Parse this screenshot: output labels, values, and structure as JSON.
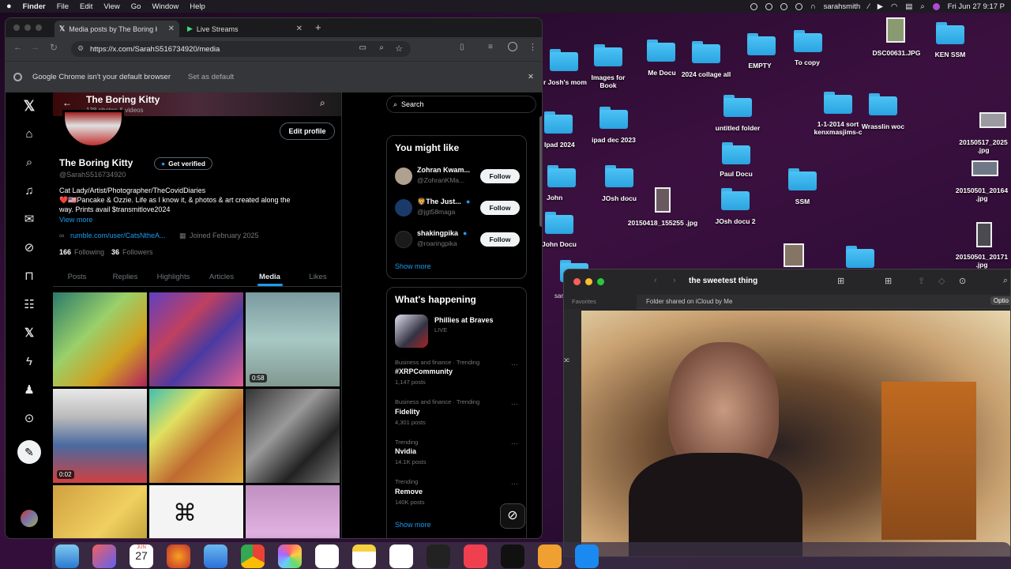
{
  "menubar": {
    "apple": "",
    "items": [
      "Finder",
      "File",
      "Edit",
      "View",
      "Go",
      "Window",
      "Help"
    ],
    "user": "sarahsmith",
    "datetime": "Fri Jun 27  9:17 P"
  },
  "chrome": {
    "tabs": [
      {
        "label": "Media posts by The Boring K",
        "icon": "x-logo-icon"
      },
      {
        "label": "Live Streams",
        "icon": "play-icon"
      }
    ],
    "url": "https://x.com/SarahS516734920/media",
    "infobar": {
      "message": "Google Chrome isn't your default browser",
      "action": "Set as default"
    }
  },
  "profile": {
    "header_name": "The Boring Kitty",
    "header_sub": "138 photos & videos",
    "edit_profile": "Edit profile",
    "display_name": "The Boring Kitty",
    "get_verified": "Get verified",
    "handle": "@SarahS516734920",
    "bio_line1": "Cat Lady/Artist/Photographer/TheCovidDiaries",
    "bio_line2": "❤️🇺🇸Pancake & Ozzie. Life as I know it, & photos & art created along the",
    "bio_line3": "way. Prints avail $transmitlove2024",
    "view_more": "View more",
    "link": "rumble.com/user/CatsNtheA...",
    "joined": "Joined February 2025",
    "following_count": "166",
    "following_label": "Following",
    "followers_count": "36",
    "followers_label": "Followers",
    "tabs": [
      "Posts",
      "Replies",
      "Highlights",
      "Articles",
      "Media",
      "Likes"
    ],
    "active_tab": "Media",
    "media": [
      {
        "badge": ""
      },
      {
        "badge": ""
      },
      {
        "badge": "0:58"
      },
      {
        "badge": "0:02"
      },
      {
        "badge": ""
      },
      {
        "badge": ""
      },
      {
        "badge": ""
      },
      {
        "badge": ""
      },
      {
        "badge": ""
      }
    ]
  },
  "sidebar": {
    "search_placeholder": "Search",
    "you_might_like": "You might like",
    "suggestions": [
      {
        "name": "Zohran Kwam...",
        "handle": "@ZohranKMa...",
        "button": "Follow"
      },
      {
        "name": "🦁The Just...",
        "handle": "@jgt58maga",
        "button": "Follow"
      },
      {
        "name": "shakingpika",
        "handle": "@roaringpika",
        "button": "Follow"
      }
    ],
    "show_more": "Show more",
    "whats_happening": "What's happening",
    "event": {
      "title": "Phillies at Braves",
      "status": "LIVE"
    },
    "trends": [
      {
        "category": "Business and finance · Trending",
        "name": "#XRPCommunity",
        "posts": "1,147 posts"
      },
      {
        "category": "Business and finance · Trending",
        "name": "Fidelity",
        "posts": "4,301 posts"
      },
      {
        "category": "Trending",
        "name": "Nvidia",
        "posts": "14.1K posts"
      },
      {
        "category": "Trending",
        "name": "Remove",
        "posts": "140K posts"
      }
    ],
    "show_more_2": "Show more"
  },
  "desktop": {
    "icons": [
      {
        "label": "",
        "kind": "folder"
      },
      {
        "label": "Images for Book",
        "kind": "folder"
      },
      {
        "label": "Me Docu",
        "kind": "folder"
      },
      {
        "label": "2024 collage all",
        "kind": "folder"
      },
      {
        "label": "EMPTY",
        "kind": "folder"
      },
      {
        "label": "To copy",
        "kind": "folder"
      },
      {
        "label": "DSC00631.JPG",
        "kind": "image"
      },
      {
        "label": "KEN SSM",
        "kind": "folder"
      },
      {
        "label": "r Josh's mom",
        "kind": "folder"
      },
      {
        "label": "untitled folder",
        "kind": "folder"
      },
      {
        "label": "1-1-2014 sort kenxmasjims-c",
        "kind": "folder"
      },
      {
        "label": "Wrasslin woc",
        "kind": "folder"
      },
      {
        "label": "Ipad 2024",
        "kind": "folder"
      },
      {
        "label": "ipad dec 2023",
        "kind": "folder"
      },
      {
        "label": "20150517_2025 .jpg",
        "kind": "image"
      },
      {
        "label": "Paul Docu",
        "kind": "folder"
      },
      {
        "label": "20150501_20164 .jpg",
        "kind": "image"
      },
      {
        "label": "John",
        "kind": "folder"
      },
      {
        "label": "JOsh docu",
        "kind": "folder"
      },
      {
        "label": "SSM",
        "kind": "folder"
      },
      {
        "label": "20150418_155255 .jpg",
        "kind": "image"
      },
      {
        "label": "JOsh docu 2",
        "kind": "folder"
      },
      {
        "label": "John Docu",
        "kind": "folder"
      },
      {
        "label": "20150501_20171 .jpg",
        "kind": "image"
      }
    ]
  },
  "finder": {
    "title": "the sweetest thing",
    "favorites": "Favorites",
    "shared_note": "Folder shared on iCloud by Me",
    "options": "Optio",
    "partial": "doc",
    "partial2": "sar"
  },
  "dock": {
    "calendar_month": "JUN",
    "calendar_day": "27"
  },
  "colors": {
    "x_blue": "#1d9bf0",
    "folder": "#4cc3f5",
    "menubar": "#1d1a22"
  }
}
